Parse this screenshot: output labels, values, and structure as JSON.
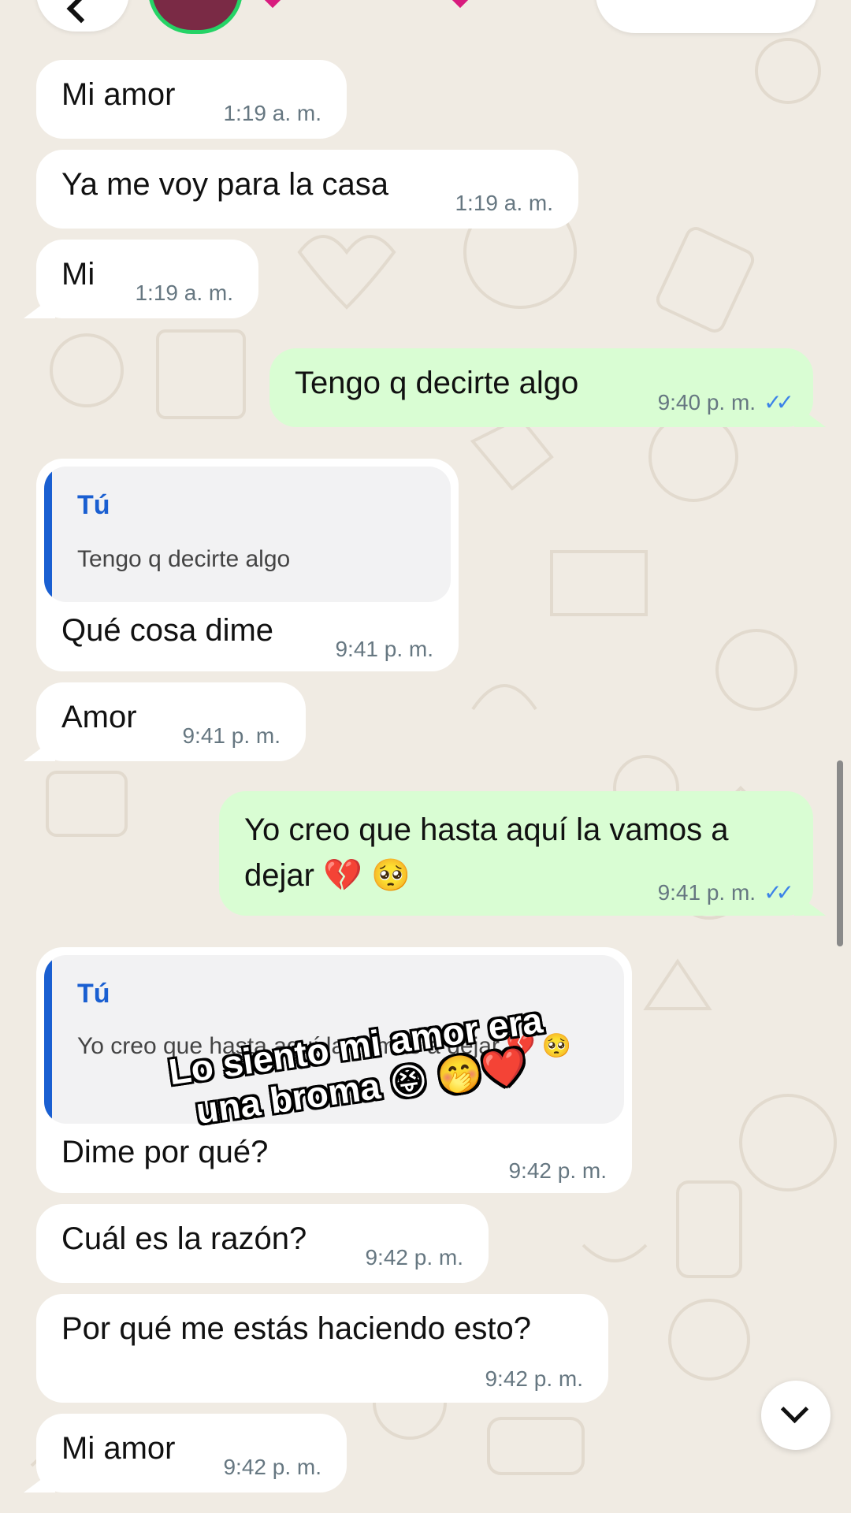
{
  "messages": [
    {
      "text": "Mi amor",
      "time": "1:19 a. m."
    },
    {
      "text": "Ya me voy para la casa",
      "time": "1:19 a. m."
    },
    {
      "text": "Mi",
      "time": "1:19 a. m."
    },
    {
      "text": "Tengo q decirte algo",
      "time": "9:40 p. m.",
      "status": "read"
    },
    {
      "text": "Qué cosa dime",
      "time": "9:41 p. m.",
      "reply_to": {
        "author": "Tú",
        "text": "Tengo q decirte algo"
      }
    },
    {
      "text": "Amor",
      "time": "9:41 p. m."
    },
    {
      "text": "Yo creo que hasta aquí la vamos a dejar 💔 🥺",
      "time": "9:41 p. m.",
      "status": "read"
    },
    {
      "text": "Dime por qué?",
      "time": "9:42 p. m.",
      "reply_to": {
        "author": "Tú",
        "text": "Yo creo que hasta aquí la vamos a dejar 💔 🥺"
      }
    },
    {
      "text": "Cuál es la razón?",
      "time": "9:42 p. m."
    },
    {
      "text": "Por qué me estás haciendo esto?",
      "time": "9:42 p. m."
    },
    {
      "text": "Mi amor",
      "time": "9:42 p. m."
    }
  ],
  "overlay_caption": "Lo siento mi amor era una broma 😝 🤭❤️",
  "read_ticks": "✓✓",
  "colors": {
    "incoming": "#ffffff",
    "outgoing": "#d9fdd3",
    "quote_accent": "#1a5fd1",
    "read_tick": "#3b82e8",
    "avatar_ring": "#25d366"
  },
  "icons": [
    "back-icon",
    "avatar",
    "scroll-down-icon"
  ]
}
